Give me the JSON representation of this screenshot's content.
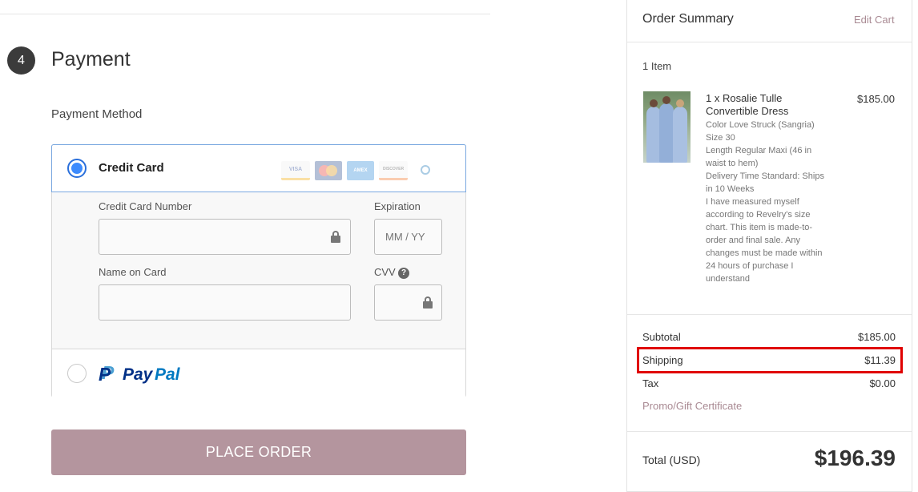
{
  "payment": {
    "step_number": "4",
    "title": "Payment",
    "method_label": "Payment Method",
    "credit_card": {
      "label": "Credit Card",
      "selected": true,
      "card_logos": [
        "VISA",
        "mastercard",
        "AMEX",
        "DISCOVER",
        "Diners"
      ],
      "number_label": "Credit Card Number",
      "number_value": "",
      "expiration_label": "Expiration",
      "expiration_placeholder": "MM / YY",
      "name_label": "Name on Card",
      "name_value": "",
      "cvv_label": "CVV",
      "cvv_help": "?"
    },
    "paypal": {
      "selected": false,
      "logo_pay": "Pay",
      "logo_pal": "Pal",
      "logo_mark": "P"
    },
    "place_order_label": "PLACE ORDER",
    "colors": {
      "accent": "#b4959e",
      "radio_selected": "#3d8bfd",
      "link": "#a98a93",
      "highlight_box": "#e00000"
    }
  },
  "summary": {
    "title": "Order Summary",
    "edit_cart": "Edit Cart",
    "item_count": "1 Item",
    "item": {
      "name": "1 x Rosalie Tulle Convertible Dress",
      "price": "$185.00",
      "details": [
        "Color Love Struck (Sangria)",
        "Size 30",
        "Length Regular Maxi (46 in waist to hem)",
        "Delivery Time Standard: Ships in 10 Weeks",
        "I have measured myself according to Revelry's size chart. This item is made-to-order and final sale. Any changes must be made within 24 hours of purchase I understand"
      ]
    },
    "subtotal_label": "Subtotal",
    "subtotal_value": "$185.00",
    "shipping_label": "Shipping",
    "shipping_value": "$11.39",
    "tax_label": "Tax",
    "tax_value": "$0.00",
    "promo_label": "Promo/Gift Certificate",
    "total_label": "Total (USD)",
    "total_value": "$196.39"
  }
}
